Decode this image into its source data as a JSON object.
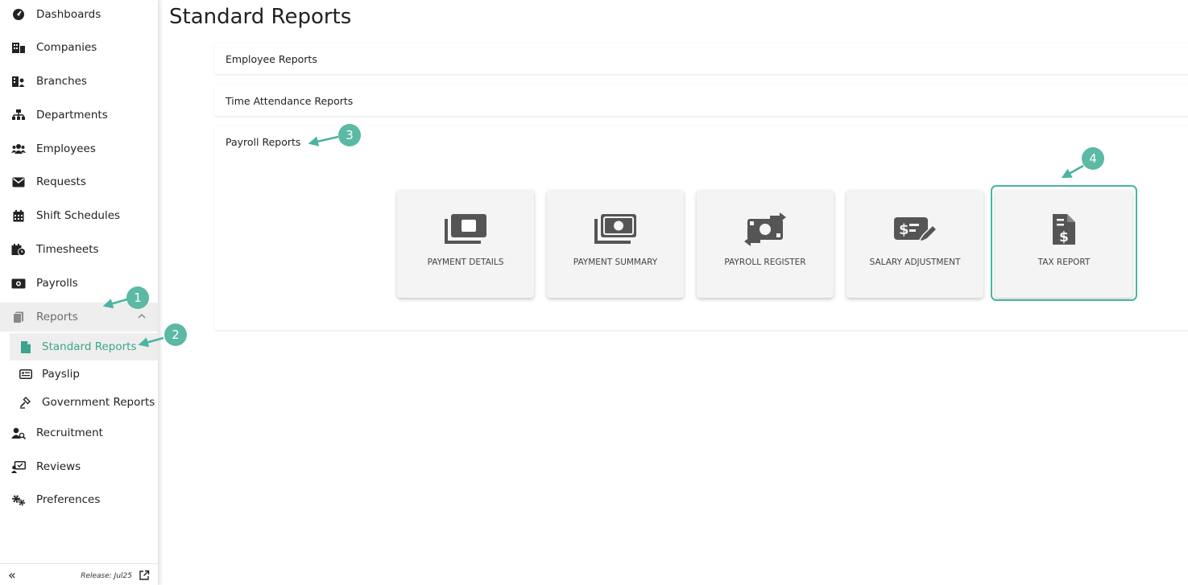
{
  "sidebar": {
    "items": [
      {
        "label": "Dashboards",
        "icon": "dashboard-icon"
      },
      {
        "label": "Companies",
        "icon": "companies-icon"
      },
      {
        "label": "Branches",
        "icon": "branches-icon"
      },
      {
        "label": "Departments",
        "icon": "departments-icon"
      },
      {
        "label": "Employees",
        "icon": "employees-icon"
      },
      {
        "label": "Requests",
        "icon": "envelope-icon"
      },
      {
        "label": "Shift Schedules",
        "icon": "calendar-icon"
      },
      {
        "label": "Timesheets",
        "icon": "timesheets-icon"
      },
      {
        "label": "Payrolls",
        "icon": "money-icon"
      },
      {
        "label": "Reports",
        "icon": "reports-icon"
      },
      {
        "label": "Recruitment",
        "icon": "recruitment-icon"
      },
      {
        "label": "Reviews",
        "icon": "reviews-icon"
      },
      {
        "label": "Preferences",
        "icon": "cogs-icon"
      }
    ],
    "sub_items": [
      {
        "label": "Standard Reports",
        "icon": "file-icon"
      },
      {
        "label": "Payslip",
        "icon": "payslip-icon"
      },
      {
        "label": "Government Reports",
        "icon": "gavel-icon"
      }
    ],
    "release": "Release: Jul25"
  },
  "main": {
    "title": "Standard Reports",
    "sections": [
      {
        "title": "Employee Reports"
      },
      {
        "title": "Time Attendance Reports"
      },
      {
        "title": "Payroll Reports"
      }
    ],
    "cards": [
      {
        "label": "PAYMENT DETAILS",
        "icon": "money-bill-icon"
      },
      {
        "label": "PAYMENT SUMMARY",
        "icon": "money-bills-icon"
      },
      {
        "label": "PAYROLL REGISTER",
        "icon": "money-transfer-icon"
      },
      {
        "label": "SALARY ADJUSTMENT",
        "icon": "money-edit-icon"
      },
      {
        "label": "TAX REPORT",
        "icon": "invoice-dollar-icon"
      }
    ]
  },
  "callouts": [
    "1",
    "2",
    "3",
    "4"
  ],
  "colors": {
    "accent": "#3aa58b",
    "callout": "#5bb9a4",
    "icon_gray": "#555555"
  }
}
